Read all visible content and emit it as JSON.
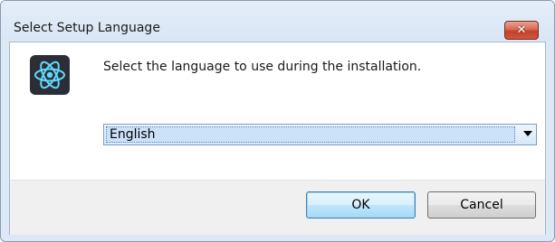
{
  "window": {
    "title": "Select Setup Language",
    "close_glyph": "✕"
  },
  "dialog": {
    "icon": "atom-icon",
    "message": "Select the language to use during the installation."
  },
  "language_select": {
    "selected": "English"
  },
  "buttons": {
    "ok": "OK",
    "cancel": "Cancel"
  },
  "colors": {
    "icon_bg": "#2b2e36",
    "icon_accent": "#61dafb",
    "close_red": "#c3412b"
  }
}
